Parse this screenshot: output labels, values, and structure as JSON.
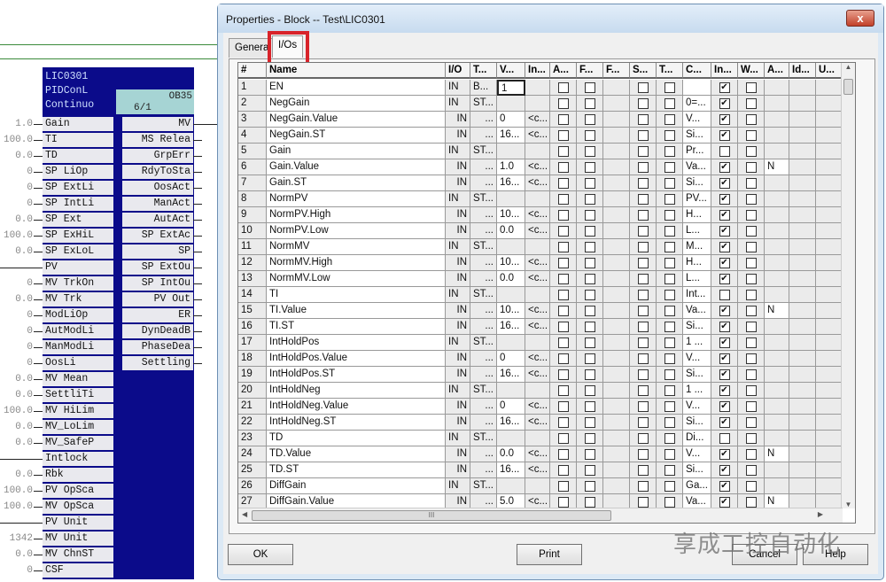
{
  "block": {
    "name": "LIC0301",
    "type": "PIDConL",
    "mode": "Continuo",
    "ob": "OB35",
    "seq": "6/1",
    "inputs": [
      [
        "Gain",
        "1.0"
      ],
      [
        "TI",
        "100.0"
      ],
      [
        "TD",
        "0.0"
      ],
      [
        "SP LiOp",
        "0"
      ],
      [
        "SP ExtLi",
        "0"
      ],
      [
        "SP IntLi",
        "0"
      ],
      [
        "SP Ext",
        "0.0"
      ],
      [
        "SP ExHiL",
        "100.0"
      ],
      [
        "SP ExLoL",
        "0.0"
      ],
      [
        "PV",
        ""
      ],
      [
        "MV TrkOn",
        "0"
      ],
      [
        "MV Trk",
        "0.0"
      ],
      [
        "ModLiOp",
        "0"
      ],
      [
        "AutModLi",
        "0"
      ],
      [
        "ManModLi",
        "0"
      ],
      [
        "OosLi",
        "0"
      ],
      [
        "MV Mean",
        "0.0"
      ],
      [
        "SettliTi",
        "0.0"
      ],
      [
        "MV HiLim",
        "100.0"
      ],
      [
        "MV_LoLim",
        "0.0"
      ],
      [
        "MV_SafeP",
        "0.0"
      ],
      [
        "Intlock",
        ""
      ],
      [
        "Rbk",
        "0.0"
      ],
      [
        "PV OpSca",
        "100.0"
      ],
      [
        "MV OpSca",
        "100.0"
      ],
      [
        "PV Unit",
        ""
      ],
      [
        "MV Unit",
        "1342"
      ],
      [
        "MV ChnST",
        "0.0"
      ],
      [
        "CSF",
        "0"
      ]
    ],
    "outputs": [
      "MV",
      "MS Relea",
      "GrpErr",
      "RdyToSta",
      "OosAct",
      "ManAct",
      "AutAct",
      "SP ExtAc",
      "SP",
      "SP ExtOu",
      "SP IntOu",
      "PV Out",
      "ER",
      "DynDeadB",
      "PhaseDea",
      "Settling"
    ]
  },
  "dialog": {
    "title": "Properties - Block -- Test\\LIC0301",
    "close": "x",
    "tabs": [
      "General",
      "I/Os"
    ],
    "active_tab": "I/Os",
    "columns": [
      "#",
      "Name",
      "I/O",
      "T...",
      "V...",
      "In...",
      "A...",
      "F...",
      "F...",
      "S...",
      "T...",
      "C...",
      "In...",
      "W...",
      "A...",
      "Id...",
      "U..."
    ],
    "rows": [
      [
        1,
        "EN",
        "IN",
        "B...",
        "1",
        "",
        "",
        true,
        ""
      ],
      [
        2,
        "NegGain",
        "IN",
        "ST...",
        "",
        "",
        "0=...",
        true,
        ""
      ],
      [
        3,
        "NegGain.Value",
        "IN",
        "...",
        "0",
        "<c...",
        "V...",
        true,
        ""
      ],
      [
        4,
        "NegGain.ST",
        "IN",
        "...",
        "16...",
        "<c...",
        "Si...",
        true,
        ""
      ],
      [
        5,
        "Gain",
        "IN",
        "ST...",
        "",
        "",
        "Pr...",
        false,
        ""
      ],
      [
        6,
        "Gain.Value",
        "IN",
        "...",
        "1.0",
        "<c...",
        "Va...",
        true,
        "N"
      ],
      [
        7,
        "Gain.ST",
        "IN",
        "...",
        "16...",
        "<c...",
        "Si...",
        true,
        ""
      ],
      [
        8,
        "NormPV",
        "IN",
        "ST...",
        "",
        "",
        "PV...",
        true,
        ""
      ],
      [
        9,
        "NormPV.High",
        "IN",
        "...",
        "10...",
        "<c...",
        "H...",
        true,
        ""
      ],
      [
        10,
        "NormPV.Low",
        "IN",
        "...",
        "0.0",
        "<c...",
        "L...",
        true,
        ""
      ],
      [
        11,
        "NormMV",
        "IN",
        "ST...",
        "",
        "",
        "M...",
        true,
        ""
      ],
      [
        12,
        "NormMV.High",
        "IN",
        "...",
        "10...",
        "<c...",
        "H...",
        true,
        ""
      ],
      [
        13,
        "NormMV.Low",
        "IN",
        "...",
        "0.0",
        "<c...",
        "L...",
        true,
        ""
      ],
      [
        14,
        "TI",
        "IN",
        "ST...",
        "",
        "",
        "Int...",
        false,
        ""
      ],
      [
        15,
        "TI.Value",
        "IN",
        "...",
        "10...",
        "<c...",
        "Va...",
        true,
        "N"
      ],
      [
        16,
        "TI.ST",
        "IN",
        "...",
        "16...",
        "<c...",
        "Si...",
        true,
        ""
      ],
      [
        17,
        "IntHoldPos",
        "IN",
        "ST...",
        "",
        "",
        "1 ...",
        true,
        ""
      ],
      [
        18,
        "IntHoldPos.Value",
        "IN",
        "...",
        "0",
        "<c...",
        "V...",
        true,
        ""
      ],
      [
        19,
        "IntHoldPos.ST",
        "IN",
        "...",
        "16...",
        "<c...",
        "Si...",
        true,
        ""
      ],
      [
        20,
        "IntHoldNeg",
        "IN",
        "ST...",
        "",
        "",
        "1 ...",
        true,
        ""
      ],
      [
        21,
        "IntHoldNeg.Value",
        "IN",
        "...",
        "0",
        "<c...",
        "V...",
        true,
        ""
      ],
      [
        22,
        "IntHoldNeg.ST",
        "IN",
        "...",
        "16...",
        "<c...",
        "Si...",
        true,
        ""
      ],
      [
        23,
        "TD",
        "IN",
        "ST...",
        "",
        "",
        "Di...",
        false,
        ""
      ],
      [
        24,
        "TD.Value",
        "IN",
        "...",
        "0.0",
        "<c...",
        "V...",
        true,
        "N"
      ],
      [
        25,
        "TD.ST",
        "IN",
        "...",
        "16...",
        "<c...",
        "Si...",
        true,
        ""
      ],
      [
        26,
        "DiffGain",
        "IN",
        "ST...",
        "",
        "",
        "Ga...",
        true,
        ""
      ],
      [
        27,
        "DiffGain.Value",
        "IN",
        "...",
        "5.0",
        "<c...",
        "Va...",
        true,
        "N"
      ]
    ],
    "buttons": {
      "ok": "OK",
      "print": "Print",
      "cancel": "Cancel",
      "help": "Help"
    },
    "scroll_grip": "III"
  },
  "watermark": "享成工控自动化",
  "colors": {
    "block": "#0b0b8a",
    "highlight": "#d8232a"
  }
}
